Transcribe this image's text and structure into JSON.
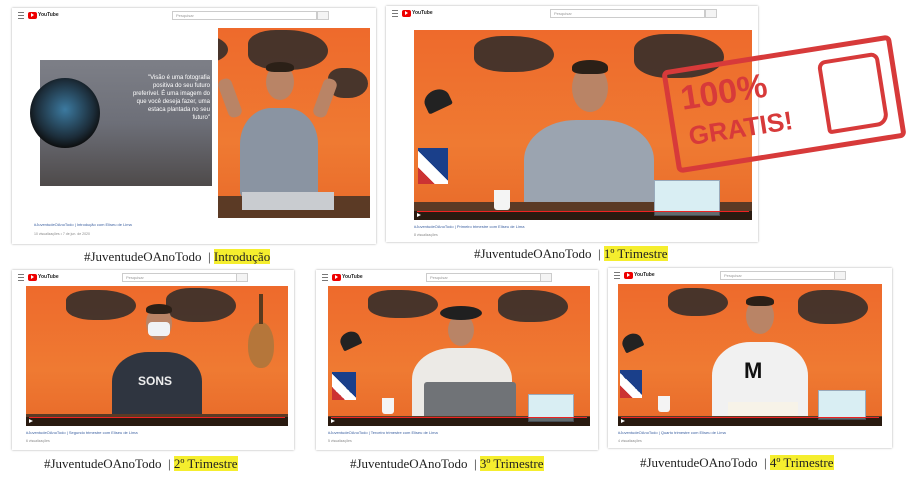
{
  "youtube": {
    "logo_text": "YouTube",
    "search_placeholder": "Pesquisar"
  },
  "videos": [
    {
      "id": "intro",
      "meta_line": "#JuventudeOAnoTodo | Introdução com Eliseu de Lima",
      "meta_sub": "10 visualizações • 7 de jun. de 2020",
      "overlay_quote": "\"Visão é uma fotografia positiva do seu futuro preferível. É uma imagem do que você deseja fazer, uma estaca plantada no seu futuro\""
    },
    {
      "id": "q1",
      "meta_line": "#JuventudeOAnoTodo | Primeiro trimestre com Eliseu de Lima",
      "meta_sub": "8 visualizações"
    },
    {
      "id": "q2",
      "meta_line": "#JuventudeOAnoTodo | Segundo trimestre com Eliseu de Lima",
      "meta_sub": "6 visualizações",
      "shirt_text": "SONS"
    },
    {
      "id": "q3",
      "meta_line": "#JuventudeOAnoTodo | Terceiro trimestre com Eliseu de Lima",
      "meta_sub": "5 visualizações"
    },
    {
      "id": "q4",
      "meta_line": "#JuventudeOAnoTodo | Quarto trimestre com Eliseu de Lima",
      "meta_sub": "4 visualizações",
      "shirt_text": "M"
    }
  ],
  "captions": [
    {
      "tag": "#JuventudeOAnoTodo",
      "sep": "|",
      "label": "Introdução"
    },
    {
      "tag": "#JuventudeOAnoTodo",
      "sep": "|",
      "label": "1º Trimestre"
    },
    {
      "tag": "#JuventudeOAnoTodo",
      "sep": "|",
      "label": "2º Trimestre"
    },
    {
      "tag": "#JuventudeOAnoTodo",
      "sep": "|",
      "label": "3º Trimestre"
    },
    {
      "tag": "#JuventudeOAnoTodo",
      "sep": "|",
      "label": "4º Trimestre"
    }
  ],
  "stamp": {
    "percent": "100%",
    "word": "GRATIS!"
  },
  "colors": {
    "highlight": "#f5ee2e",
    "youtube_red": "#ee0000",
    "stamp_red": "#d73a3a",
    "backdrop_orange": "#ee6a2c"
  }
}
